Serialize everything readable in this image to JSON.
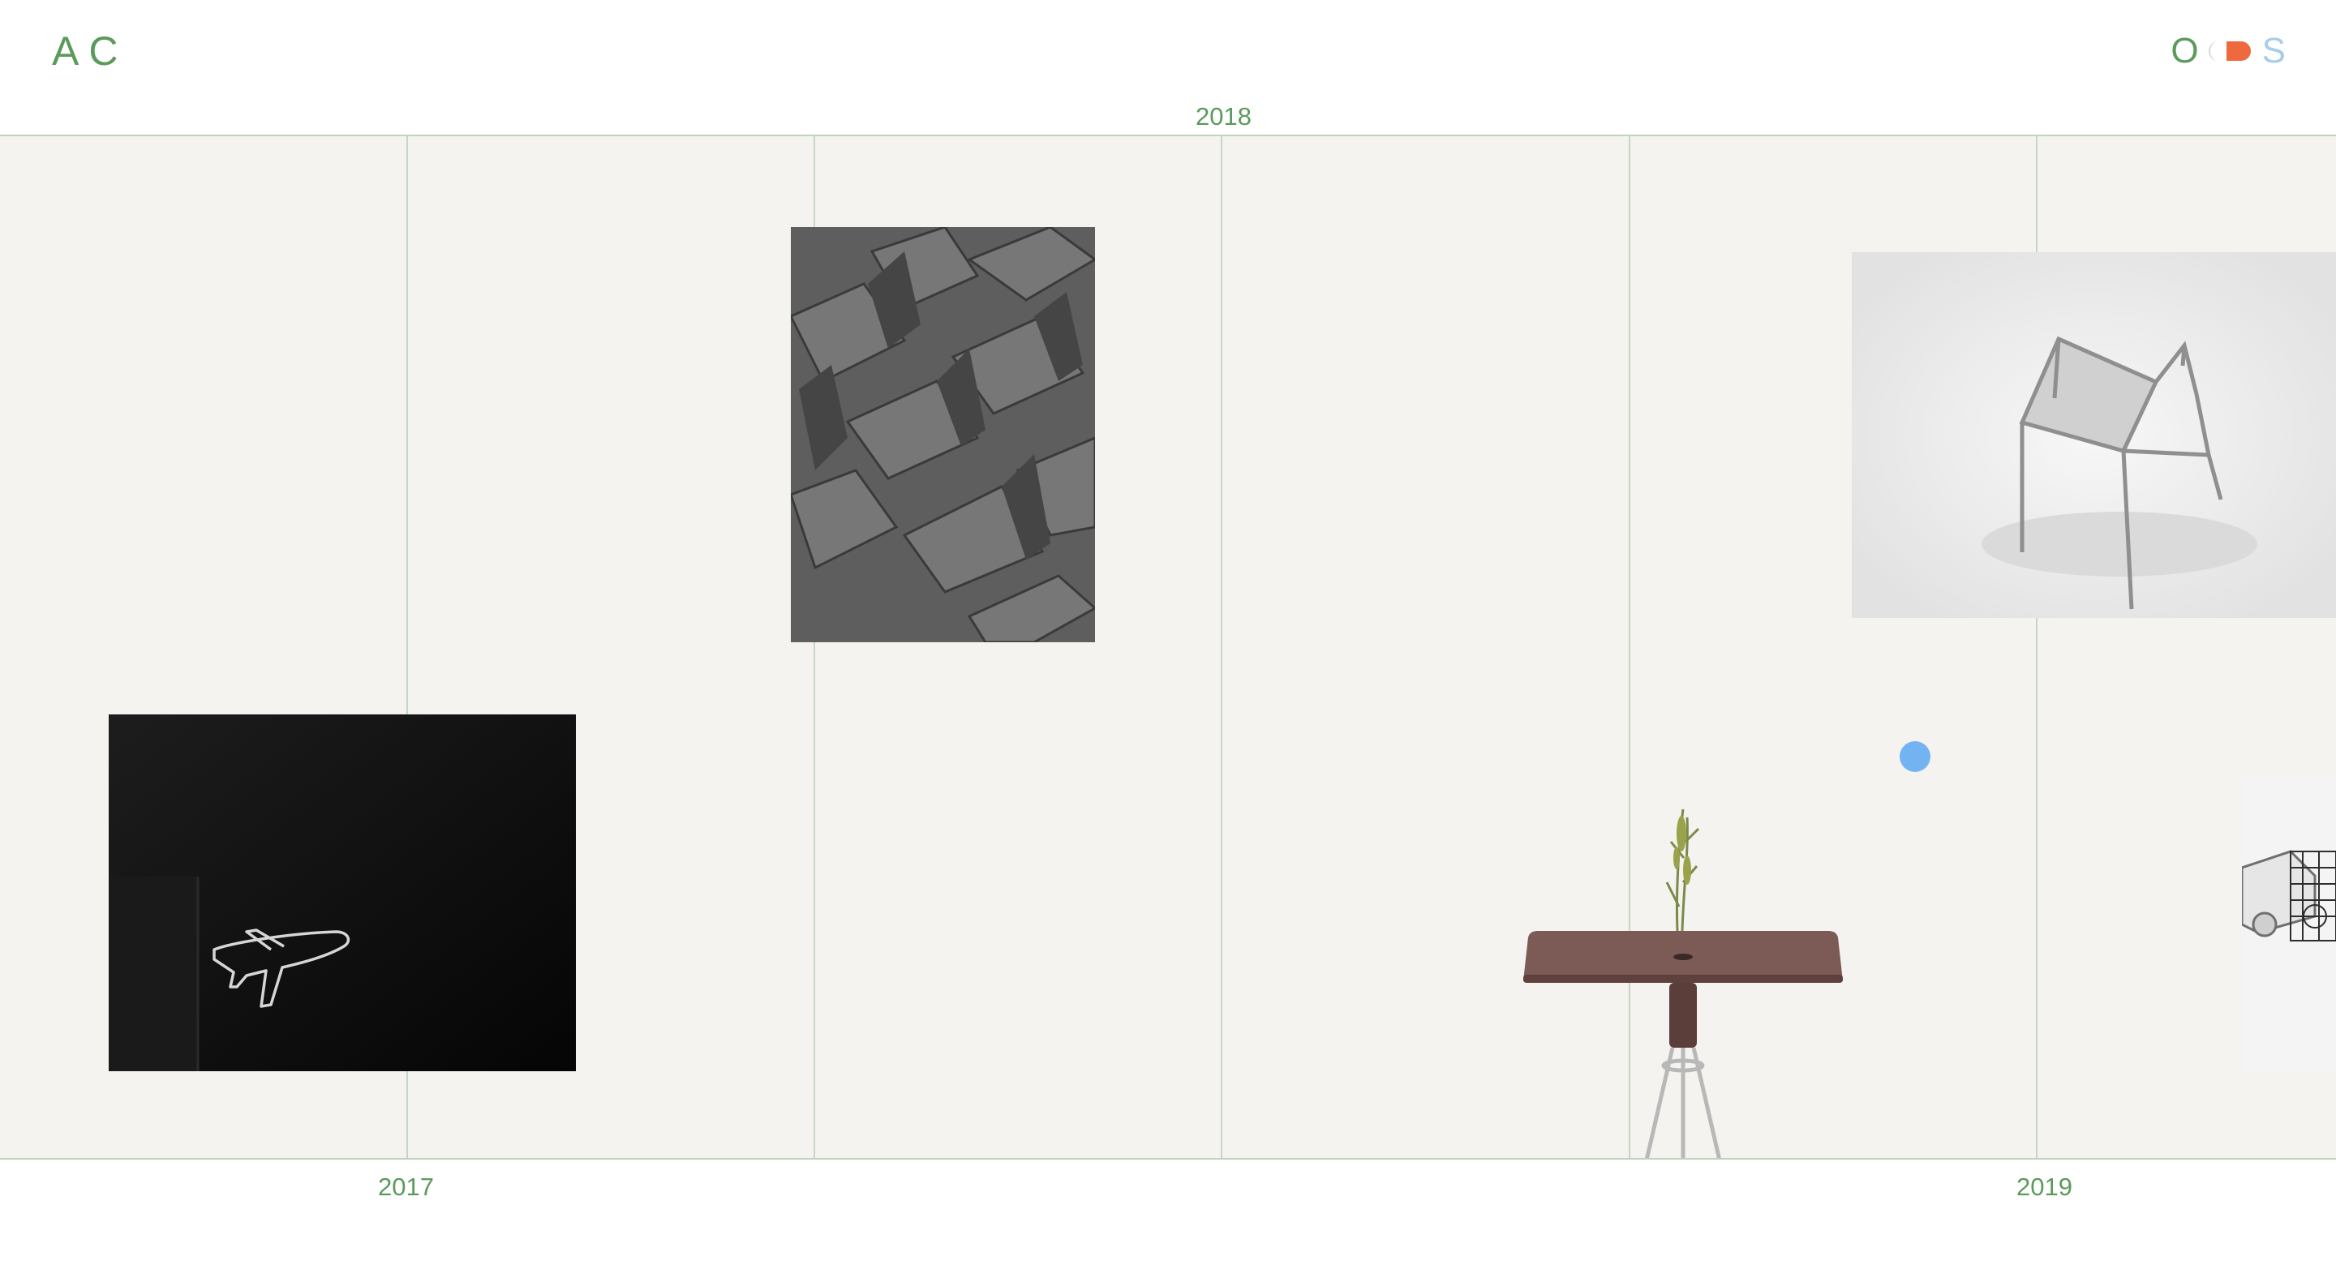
{
  "header": {
    "logo": "AC",
    "toggle": {
      "left_label": "O",
      "right_label": "S"
    }
  },
  "timeline": {
    "years": [
      "2018",
      "2017",
      "2019"
    ]
  },
  "colors": {
    "accent_green": "#5c9a5c",
    "toggle_orange": "#ee6a3e",
    "toggle_blue": "#a7cdea",
    "cursor_blue": "#74b3f2",
    "panel_bg": "#f4f3ef"
  },
  "images": [
    {
      "name": "airplane-neon-sign-image",
      "icon": "airplane-icon"
    },
    {
      "name": "auditorium-seats-image"
    },
    {
      "name": "wire-chair-image"
    },
    {
      "name": "side-table-with-vase-image"
    },
    {
      "name": "vehicle-render-image"
    }
  ]
}
